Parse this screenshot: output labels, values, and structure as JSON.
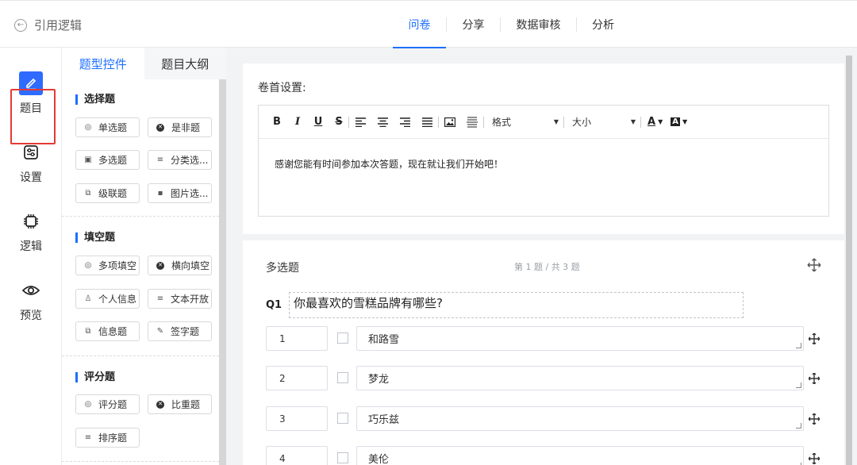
{
  "header": {
    "back_label": "引用逻辑",
    "tabs": [
      {
        "label": "问卷",
        "active": true
      },
      {
        "label": "分享",
        "active": false
      },
      {
        "label": "数据审核",
        "active": false
      },
      {
        "label": "分析",
        "active": false
      }
    ],
    "accent_color": "#1e6fff"
  },
  "rail": {
    "items": [
      {
        "label": "题目",
        "icon": "pencil-icon",
        "active": true
      },
      {
        "label": "设置",
        "icon": "settings-sliders-icon",
        "active": false,
        "highlighted": true
      },
      {
        "label": "逻辑",
        "icon": "chip-icon",
        "active": false
      },
      {
        "label": "预览",
        "icon": "eye-icon",
        "active": false
      }
    ],
    "highlight_color": "#e53935"
  },
  "panel": {
    "tabs": [
      {
        "label": "题型控件",
        "active": true
      },
      {
        "label": "题目大纲",
        "active": false
      }
    ],
    "sections": [
      {
        "title": "选择题",
        "controls": [
          {
            "label": "单选题",
            "icon": "radio-circle-icon"
          },
          {
            "label": "是非题",
            "icon": "close-circle-icon"
          },
          {
            "label": "多选题",
            "icon": "checkbox-icon"
          },
          {
            "label": "分类选...",
            "icon": "list-icon"
          },
          {
            "label": "级联题",
            "icon": "cascade-icon"
          },
          {
            "label": "图片选...",
            "icon": "image-icon"
          }
        ]
      },
      {
        "title": "填空题",
        "controls": [
          {
            "label": "多项填空",
            "icon": "radio-circle-icon"
          },
          {
            "label": "横向填空",
            "icon": "close-circle-icon"
          },
          {
            "label": "个人信息",
            "icon": "user-icon"
          },
          {
            "label": "文本开放",
            "icon": "list-icon"
          },
          {
            "label": "信息题",
            "icon": "cascade-icon"
          },
          {
            "label": "签字题",
            "icon": "signature-icon"
          }
        ]
      },
      {
        "title": "评分题",
        "controls": [
          {
            "label": "评分题",
            "icon": "radio-circle-icon"
          },
          {
            "label": "比重题",
            "icon": "close-circle-icon"
          },
          {
            "label": "排序题",
            "icon": "list-icon"
          }
        ]
      }
    ]
  },
  "header_settings": {
    "label": "卷首设置:",
    "toolbar": {
      "bold": "B",
      "italic": "I",
      "underline": "U",
      "strike": "S",
      "format_label": "格式",
      "size_label": "大小",
      "font_color": "A",
      "bg_color": "A"
    },
    "content": "感谢您能有时间参加本次答题，现在就让我们开始吧！"
  },
  "question": {
    "type_label": "多选题",
    "progress": "第 1 题 / 共 3 题",
    "number": "Q1",
    "title": "你最喜欢的雪糕品牌有哪些?",
    "options": [
      {
        "index": "1",
        "text": "和路雪"
      },
      {
        "index": "2",
        "text": "梦龙"
      },
      {
        "index": "3",
        "text": "巧乐兹"
      },
      {
        "index": "4",
        "text": "美伦"
      }
    ]
  }
}
